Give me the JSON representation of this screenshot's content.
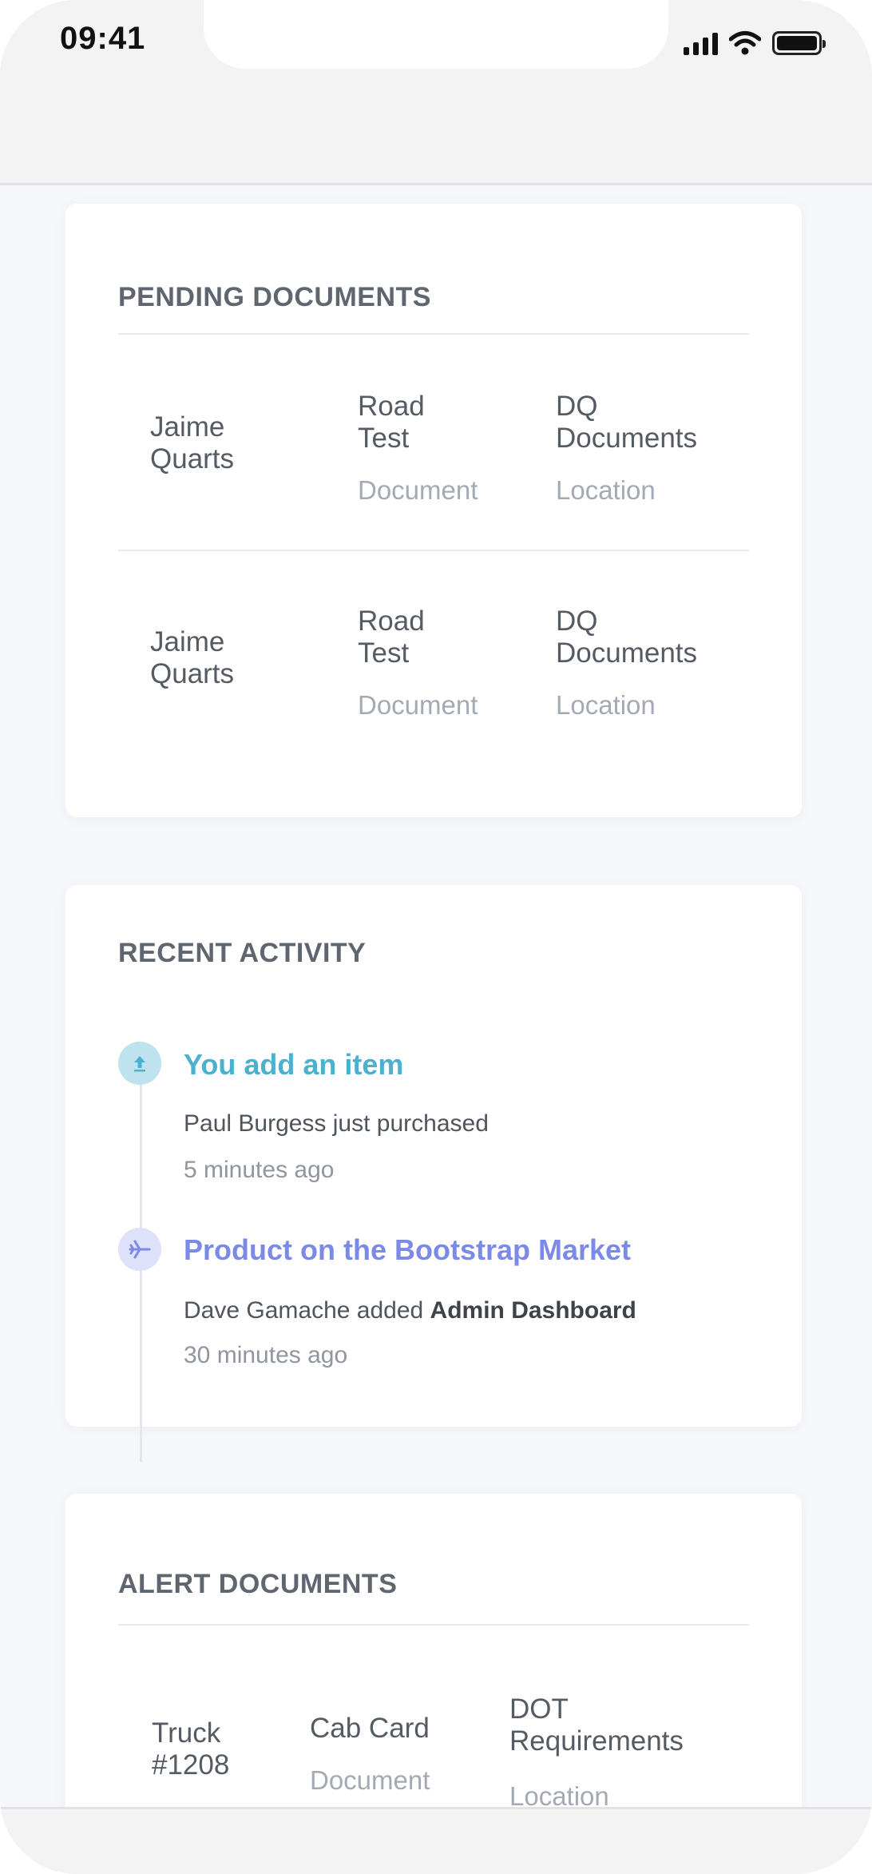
{
  "status_bar": {
    "time": "09:41"
  },
  "pending": {
    "title": "PENDING DOCUMENTS",
    "rows": [
      {
        "name_line1": "Jaime",
        "name_line2": "Quarts",
        "doc_line1": "Road",
        "doc_line2": "Test",
        "doc_label": "Document",
        "loc_line1": "DQ",
        "loc_line2": "Documents",
        "loc_label": "Location"
      },
      {
        "name_line1": "Jaime",
        "name_line2": "Quarts",
        "doc_line1": "Road",
        "doc_line2": "Test",
        "doc_label": "Document",
        "loc_line1": "DQ",
        "loc_line2": "Documents",
        "loc_label": "Location"
      }
    ]
  },
  "activity": {
    "title": "RECENT ACTIVITY",
    "items": [
      {
        "title": "You add an item",
        "desc": "Paul Burgess just purchased",
        "time": "5 minutes ago",
        "icon": "upload-icon",
        "color": "#4cb0cf",
        "dot_bg": "#bfe3ee"
      },
      {
        "title": "Product on the Bootstrap Market",
        "desc_prefix": "Dave Gamache added ",
        "desc_bold": "Admin Dashboard",
        "time": "30 minutes ago",
        "icon": "airplane-icon",
        "color": "#7b8ae6",
        "dot_bg": "#dde1fa"
      }
    ]
  },
  "alerts": {
    "title": "ALERT DOCUMENTS",
    "rows": [
      {
        "name_line1": "Truck",
        "name_line2": "#1208",
        "doc_line1": "Cab Card",
        "doc_label": "Document",
        "loc_line1": "DOT",
        "loc_line2": "Requirements",
        "loc_label": "Location"
      }
    ]
  }
}
